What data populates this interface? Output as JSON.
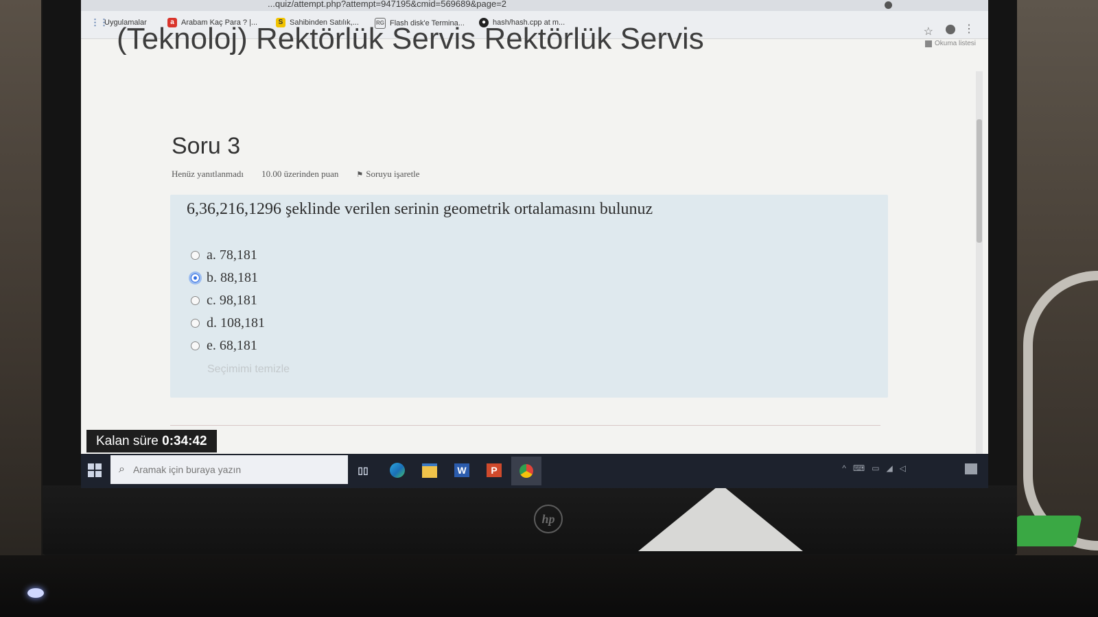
{
  "browser": {
    "url": "...quiz/attempt.php?attempt=947195&cmid=569689&page=2",
    "bookmarks": [
      {
        "label": "Uygulamalar",
        "icon": "apps-grid-icon"
      },
      {
        "label": "Arabam Kaç Para ? |...",
        "icon": "arabam-favicon"
      },
      {
        "label": "Sahibinden Satılık,...",
        "icon": "sahibinden-favicon"
      },
      {
        "label": "Flash disk'e Termina...",
        "icon": "rg-favicon"
      },
      {
        "label": "hash/hash.cpp at m...",
        "icon": "github-icon"
      }
    ],
    "reading_list": "Okuma listesi"
  },
  "page": {
    "course_title": "(Teknoloj) Rektörlük Servis Rektörlük Servis"
  },
  "question": {
    "title": "Soru 3",
    "status": "Henüz yanıtlanmadı",
    "points": "10.00 üzerinden puan",
    "flag_label": "Soruyu işaretle",
    "text": "6,36,216,1296 şeklinde verilen serinin geometrik ortalamasını bulunuz",
    "answers": [
      {
        "label": "a. 78,181",
        "selected": false
      },
      {
        "label": "b. 88,181",
        "selected": true
      },
      {
        "label": "c. 98,181",
        "selected": false
      },
      {
        "label": "d. 108,181",
        "selected": false
      },
      {
        "label": "e. 68,181",
        "selected": false
      }
    ],
    "clear_choice": "Seçimimi temizle"
  },
  "timer": {
    "label": "Kalan süre",
    "value": "0:34:42"
  },
  "taskbar": {
    "search_placeholder": "Aramak için buraya yazın",
    "apps": [
      "task-view-icon",
      "edge-icon",
      "file-explorer-icon",
      "word-icon",
      "powerpoint-icon",
      "chrome-icon"
    ]
  },
  "colors": {
    "question_bg": "#dfe9ee",
    "selected_radio": "#2f6ce1",
    "taskbar": "#1d222d"
  }
}
